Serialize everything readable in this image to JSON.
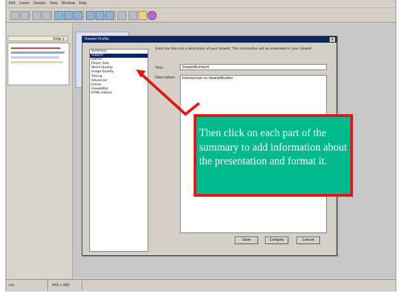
{
  "menu": [
    "Edit",
    "Insert",
    "Viewlet",
    "View",
    "Window",
    "Help"
  ],
  "slide_pane": {
    "header": "Slide 1"
  },
  "dialog": {
    "title": "Viewlet Profile",
    "close_glyph": "×",
    "nav_items": [
      "Summary",
      "Subject",
      "Author",
      "Player Size",
      "World Quality",
      "Image Quality",
      "Timing",
      "Advanced",
      "Extras",
      "ViewletBar",
      "HTML Editors"
    ],
    "selected_index": 1,
    "description": "Enter the title and a description of your Viewlet. This information will be embedded in your Viewlet.",
    "title_label": "Title:",
    "title_value": "ViewletBuilder4",
    "description_label": "Description:",
    "description_value": "Introduction to ViewletBuilder",
    "buttons": {
      "save": "Save",
      "compile": "Compile",
      "cancel": "Cancel"
    }
  },
  "status": {
    "left": "ms",
    "size": "640 x 480"
  },
  "callout": {
    "text": "Then click on each part of the summary to add information about the presentation and format it.",
    "fill": "#00b98c",
    "border": "#e81414"
  }
}
